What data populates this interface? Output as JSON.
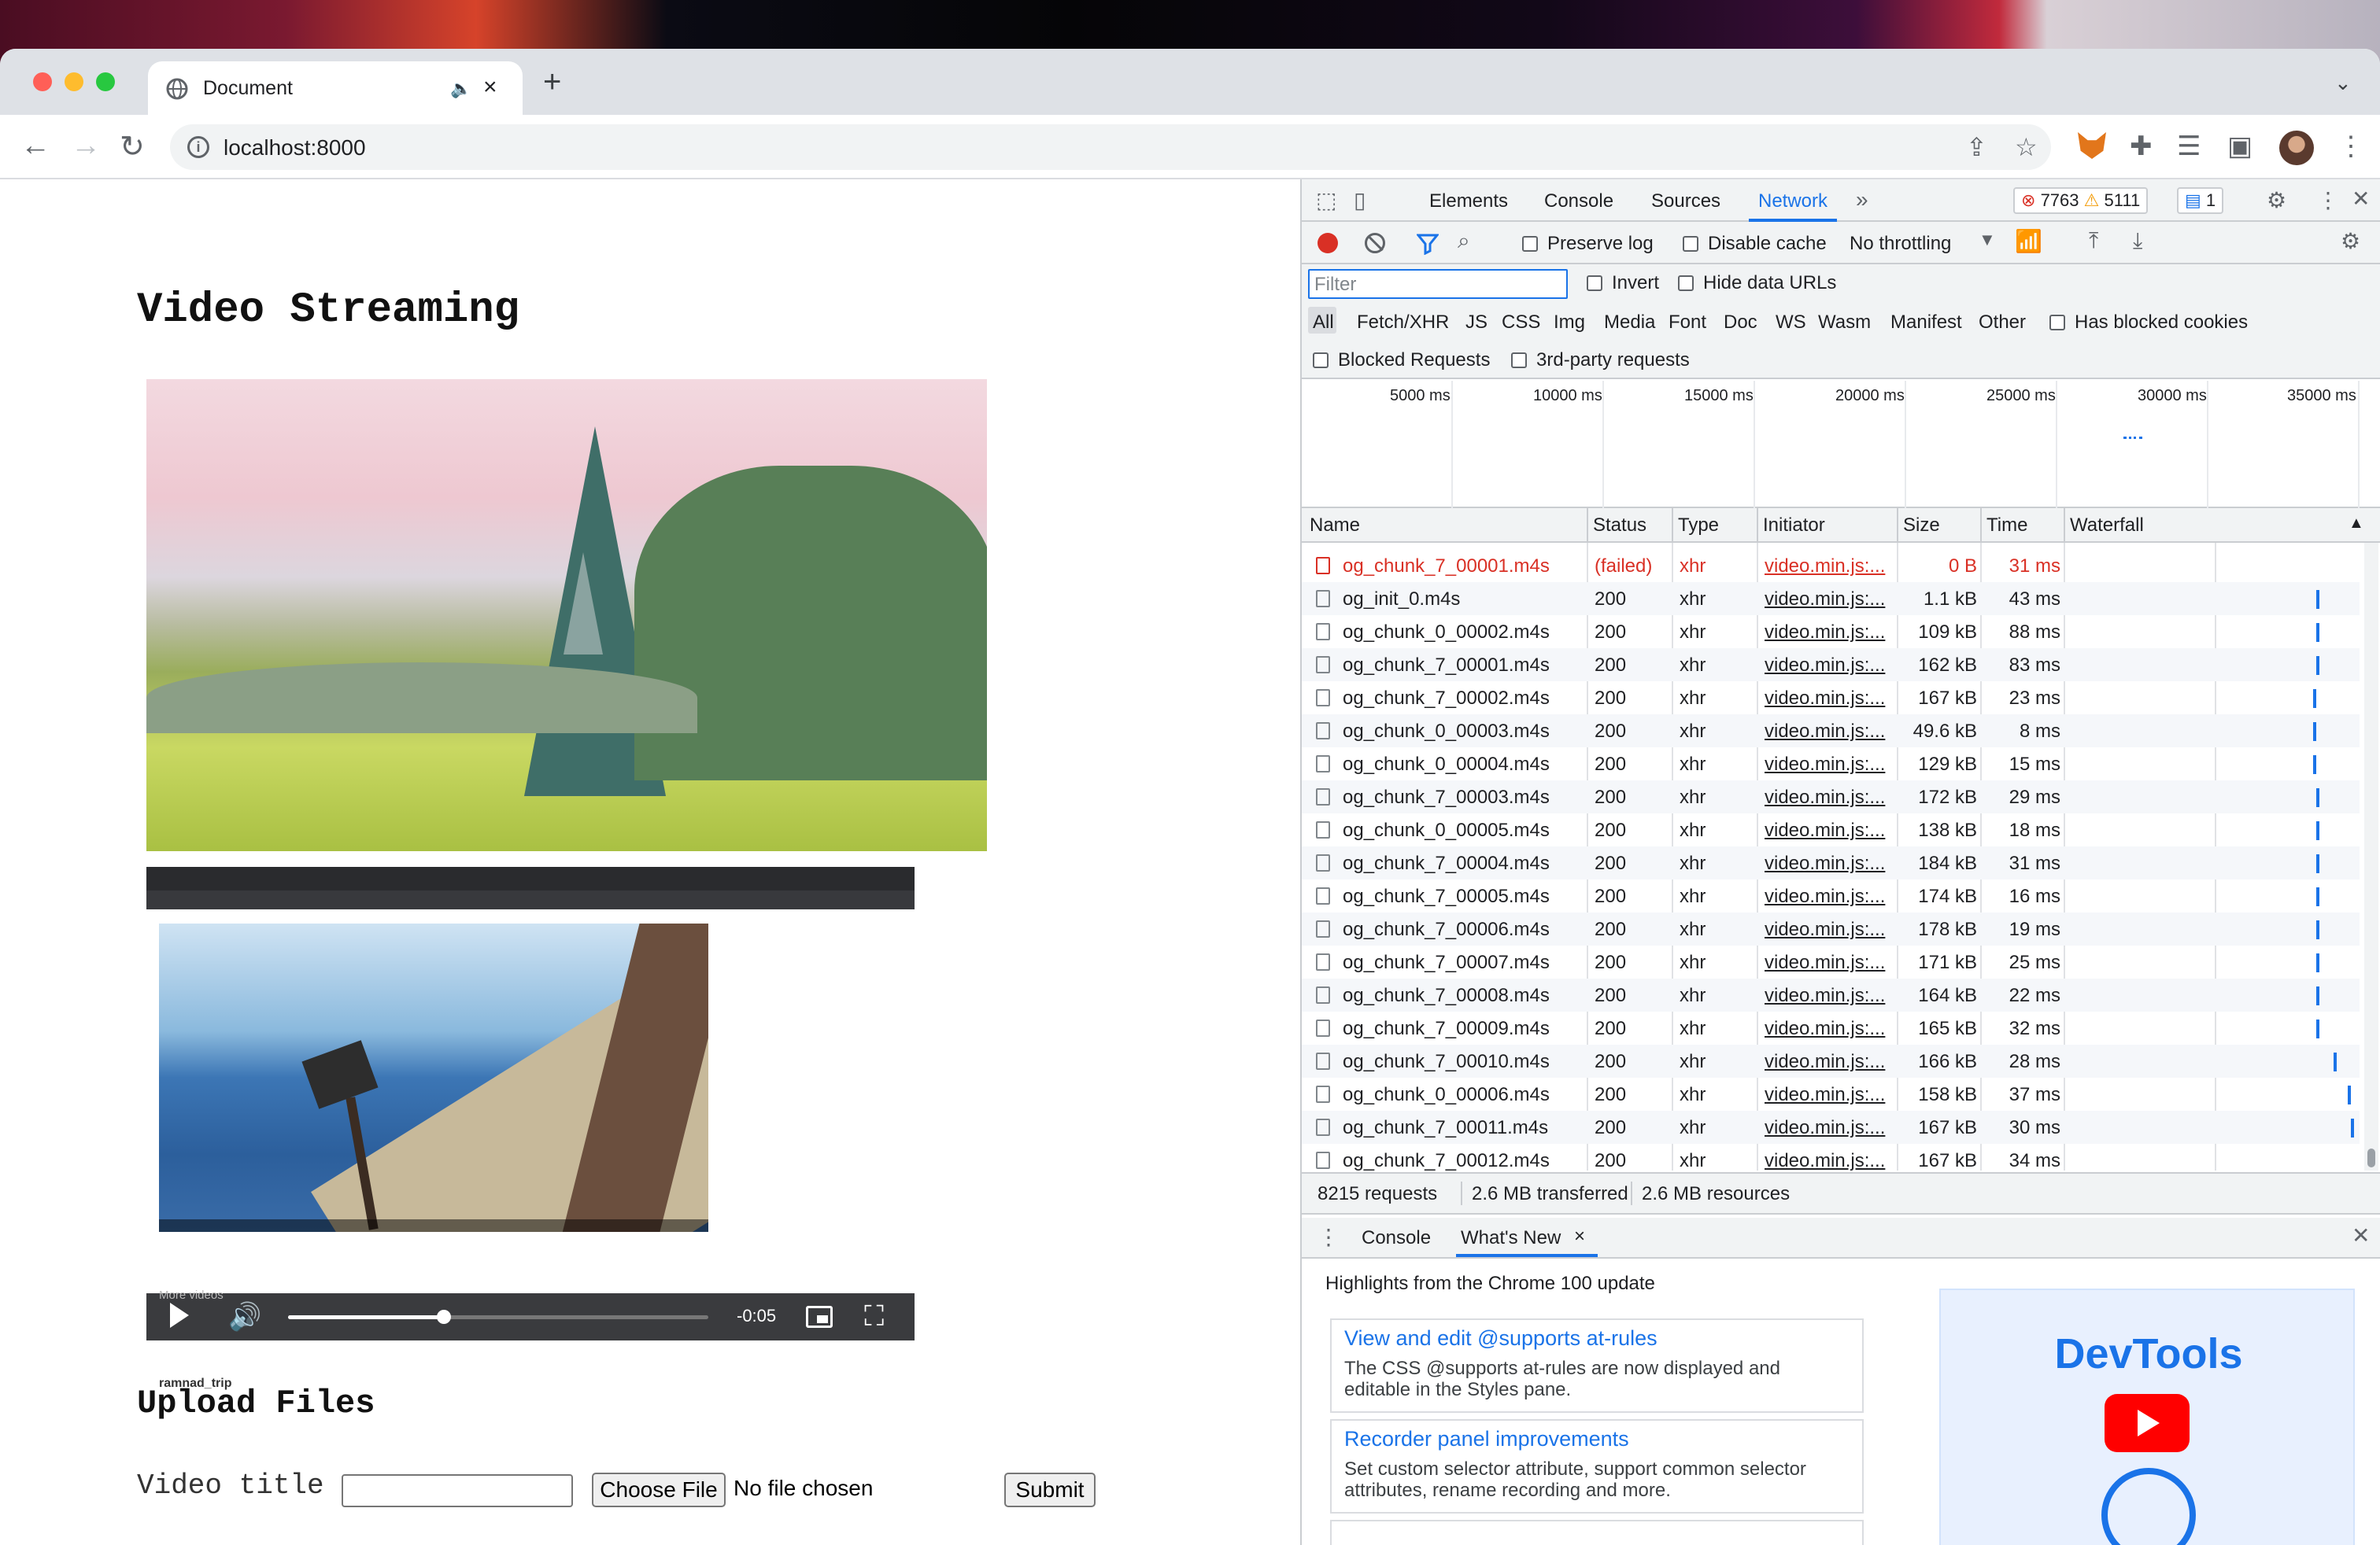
{
  "browser": {
    "tab_title": "Document",
    "new_tab": "+",
    "url": "localhost:8000",
    "colors": {
      "close": "#ff5f57",
      "min": "#febc2e",
      "max": "#28c840"
    }
  },
  "page": {
    "heading": "Video Streaming",
    "video2_caption": "ramnad_trip",
    "more_videos": "More videos",
    "player_time": "-0:05",
    "player_progress": 0.37,
    "upload_heading": "Upload Files",
    "video_title_label": "Video title",
    "choose_file": "Choose File",
    "no_file": "No file chosen",
    "submit": "Submit"
  },
  "devtools": {
    "tabs": [
      "Elements",
      "Console",
      "Sources",
      "Network"
    ],
    "active_tab": "Network",
    "errors": "7763",
    "warnings": "5111",
    "messages": "1",
    "preserve_log": "Preserve log",
    "disable_cache": "Disable cache",
    "throttling": "No throttling",
    "filter_placeholder": "Filter",
    "invert": "Invert",
    "hide_data_urls": "Hide data URLs",
    "types": [
      "All",
      "Fetch/XHR",
      "JS",
      "CSS",
      "Img",
      "Media",
      "Font",
      "Doc",
      "WS",
      "Wasm",
      "Manifest",
      "Other"
    ],
    "has_blocked_cookies": "Has blocked cookies",
    "blocked_requests": "Blocked Requests",
    "third_party": "3rd-party requests",
    "timeline_ticks": [
      "5000 ms",
      "10000 ms",
      "15000 ms",
      "20000 ms",
      "25000 ms",
      "30000 ms",
      "35000 ms"
    ],
    "columns": [
      "Name",
      "Status",
      "Type",
      "Initiator",
      "Size",
      "Time",
      "Waterfall"
    ],
    "rows": [
      {
        "name": "og_chunk_7_00001.m4s",
        "status": "(failed)",
        "type": "xhr",
        "initiator": "video.min.js:...",
        "size": "0 B",
        "time": "31 ms",
        "failed": true,
        "wf": 0
      },
      {
        "name": "og_init_0.m4s",
        "status": "200",
        "type": "xhr",
        "initiator": "video.min.js:...",
        "size": "1.1 kB",
        "time": "43 ms",
        "wf": 0.86
      },
      {
        "name": "og_chunk_0_00002.m4s",
        "status": "200",
        "type": "xhr",
        "initiator": "video.min.js:...",
        "size": "109 kB",
        "time": "88 ms",
        "wf": 0.86
      },
      {
        "name": "og_chunk_7_00001.m4s",
        "status": "200",
        "type": "xhr",
        "initiator": "video.min.js:...",
        "size": "162 kB",
        "time": "83 ms",
        "wf": 0.86
      },
      {
        "name": "og_chunk_7_00002.m4s",
        "status": "200",
        "type": "xhr",
        "initiator": "video.min.js:...",
        "size": "167 kB",
        "time": "23 ms",
        "wf": 0.85
      },
      {
        "name": "og_chunk_0_00003.m4s",
        "status": "200",
        "type": "xhr",
        "initiator": "video.min.js:...",
        "size": "49.6 kB",
        "time": "8 ms",
        "wf": 0.85
      },
      {
        "name": "og_chunk_0_00004.m4s",
        "status": "200",
        "type": "xhr",
        "initiator": "video.min.js:...",
        "size": "129 kB",
        "time": "15 ms",
        "wf": 0.85
      },
      {
        "name": "og_chunk_7_00003.m4s",
        "status": "200",
        "type": "xhr",
        "initiator": "video.min.js:...",
        "size": "172 kB",
        "time": "29 ms",
        "wf": 0.86
      },
      {
        "name": "og_chunk_0_00005.m4s",
        "status": "200",
        "type": "xhr",
        "initiator": "video.min.js:...",
        "size": "138 kB",
        "time": "18 ms",
        "wf": 0.86
      },
      {
        "name": "og_chunk_7_00004.m4s",
        "status": "200",
        "type": "xhr",
        "initiator": "video.min.js:...",
        "size": "184 kB",
        "time": "31 ms",
        "wf": 0.86
      },
      {
        "name": "og_chunk_7_00005.m4s",
        "status": "200",
        "type": "xhr",
        "initiator": "video.min.js:...",
        "size": "174 kB",
        "time": "16 ms",
        "wf": 0.86
      },
      {
        "name": "og_chunk_7_00006.m4s",
        "status": "200",
        "type": "xhr",
        "initiator": "video.min.js:...",
        "size": "178 kB",
        "time": "19 ms",
        "wf": 0.86
      },
      {
        "name": "og_chunk_7_00007.m4s",
        "status": "200",
        "type": "xhr",
        "initiator": "video.min.js:...",
        "size": "171 kB",
        "time": "25 ms",
        "wf": 0.86
      },
      {
        "name": "og_chunk_7_00008.m4s",
        "status": "200",
        "type": "xhr",
        "initiator": "video.min.js:...",
        "size": "164 kB",
        "time": "22 ms",
        "wf": 0.86
      },
      {
        "name": "og_chunk_7_00009.m4s",
        "status": "200",
        "type": "xhr",
        "initiator": "video.min.js:...",
        "size": "165 kB",
        "time": "32 ms",
        "wf": 0.86
      },
      {
        "name": "og_chunk_7_00010.m4s",
        "status": "200",
        "type": "xhr",
        "initiator": "video.min.js:...",
        "size": "166 kB",
        "time": "28 ms",
        "wf": 0.92
      },
      {
        "name": "og_chunk_0_00006.m4s",
        "status": "200",
        "type": "xhr",
        "initiator": "video.min.js:...",
        "size": "158 kB",
        "time": "37 ms",
        "wf": 0.97
      },
      {
        "name": "og_chunk_7_00011.m4s",
        "status": "200",
        "type": "xhr",
        "initiator": "video.min.js:...",
        "size": "167 kB",
        "time": "30 ms",
        "wf": 0.98
      },
      {
        "name": "og_chunk_7_00012.m4s",
        "status": "200",
        "type": "xhr",
        "initiator": "video.min.js:...",
        "size": "167 kB",
        "time": "34 ms",
        "wf": 0
      }
    ],
    "summary": {
      "requests": "8215 requests",
      "transferred": "2.6 MB transferred",
      "resources": "2.6 MB resources"
    },
    "drawer_tabs": [
      "Console",
      "What's New"
    ],
    "drawer_active": "What's New",
    "highlights": "Highlights from the Chrome 100 update",
    "cards": [
      {
        "title": "View and edit @supports at-rules",
        "desc": "The CSS @supports at-rules are now displayed and editable in the Styles pane."
      },
      {
        "title": "Recorder panel improvements",
        "desc": "Set custom selector attribute, support common selector attributes, rename recording and more."
      }
    ],
    "promo_title": "DevTools"
  }
}
